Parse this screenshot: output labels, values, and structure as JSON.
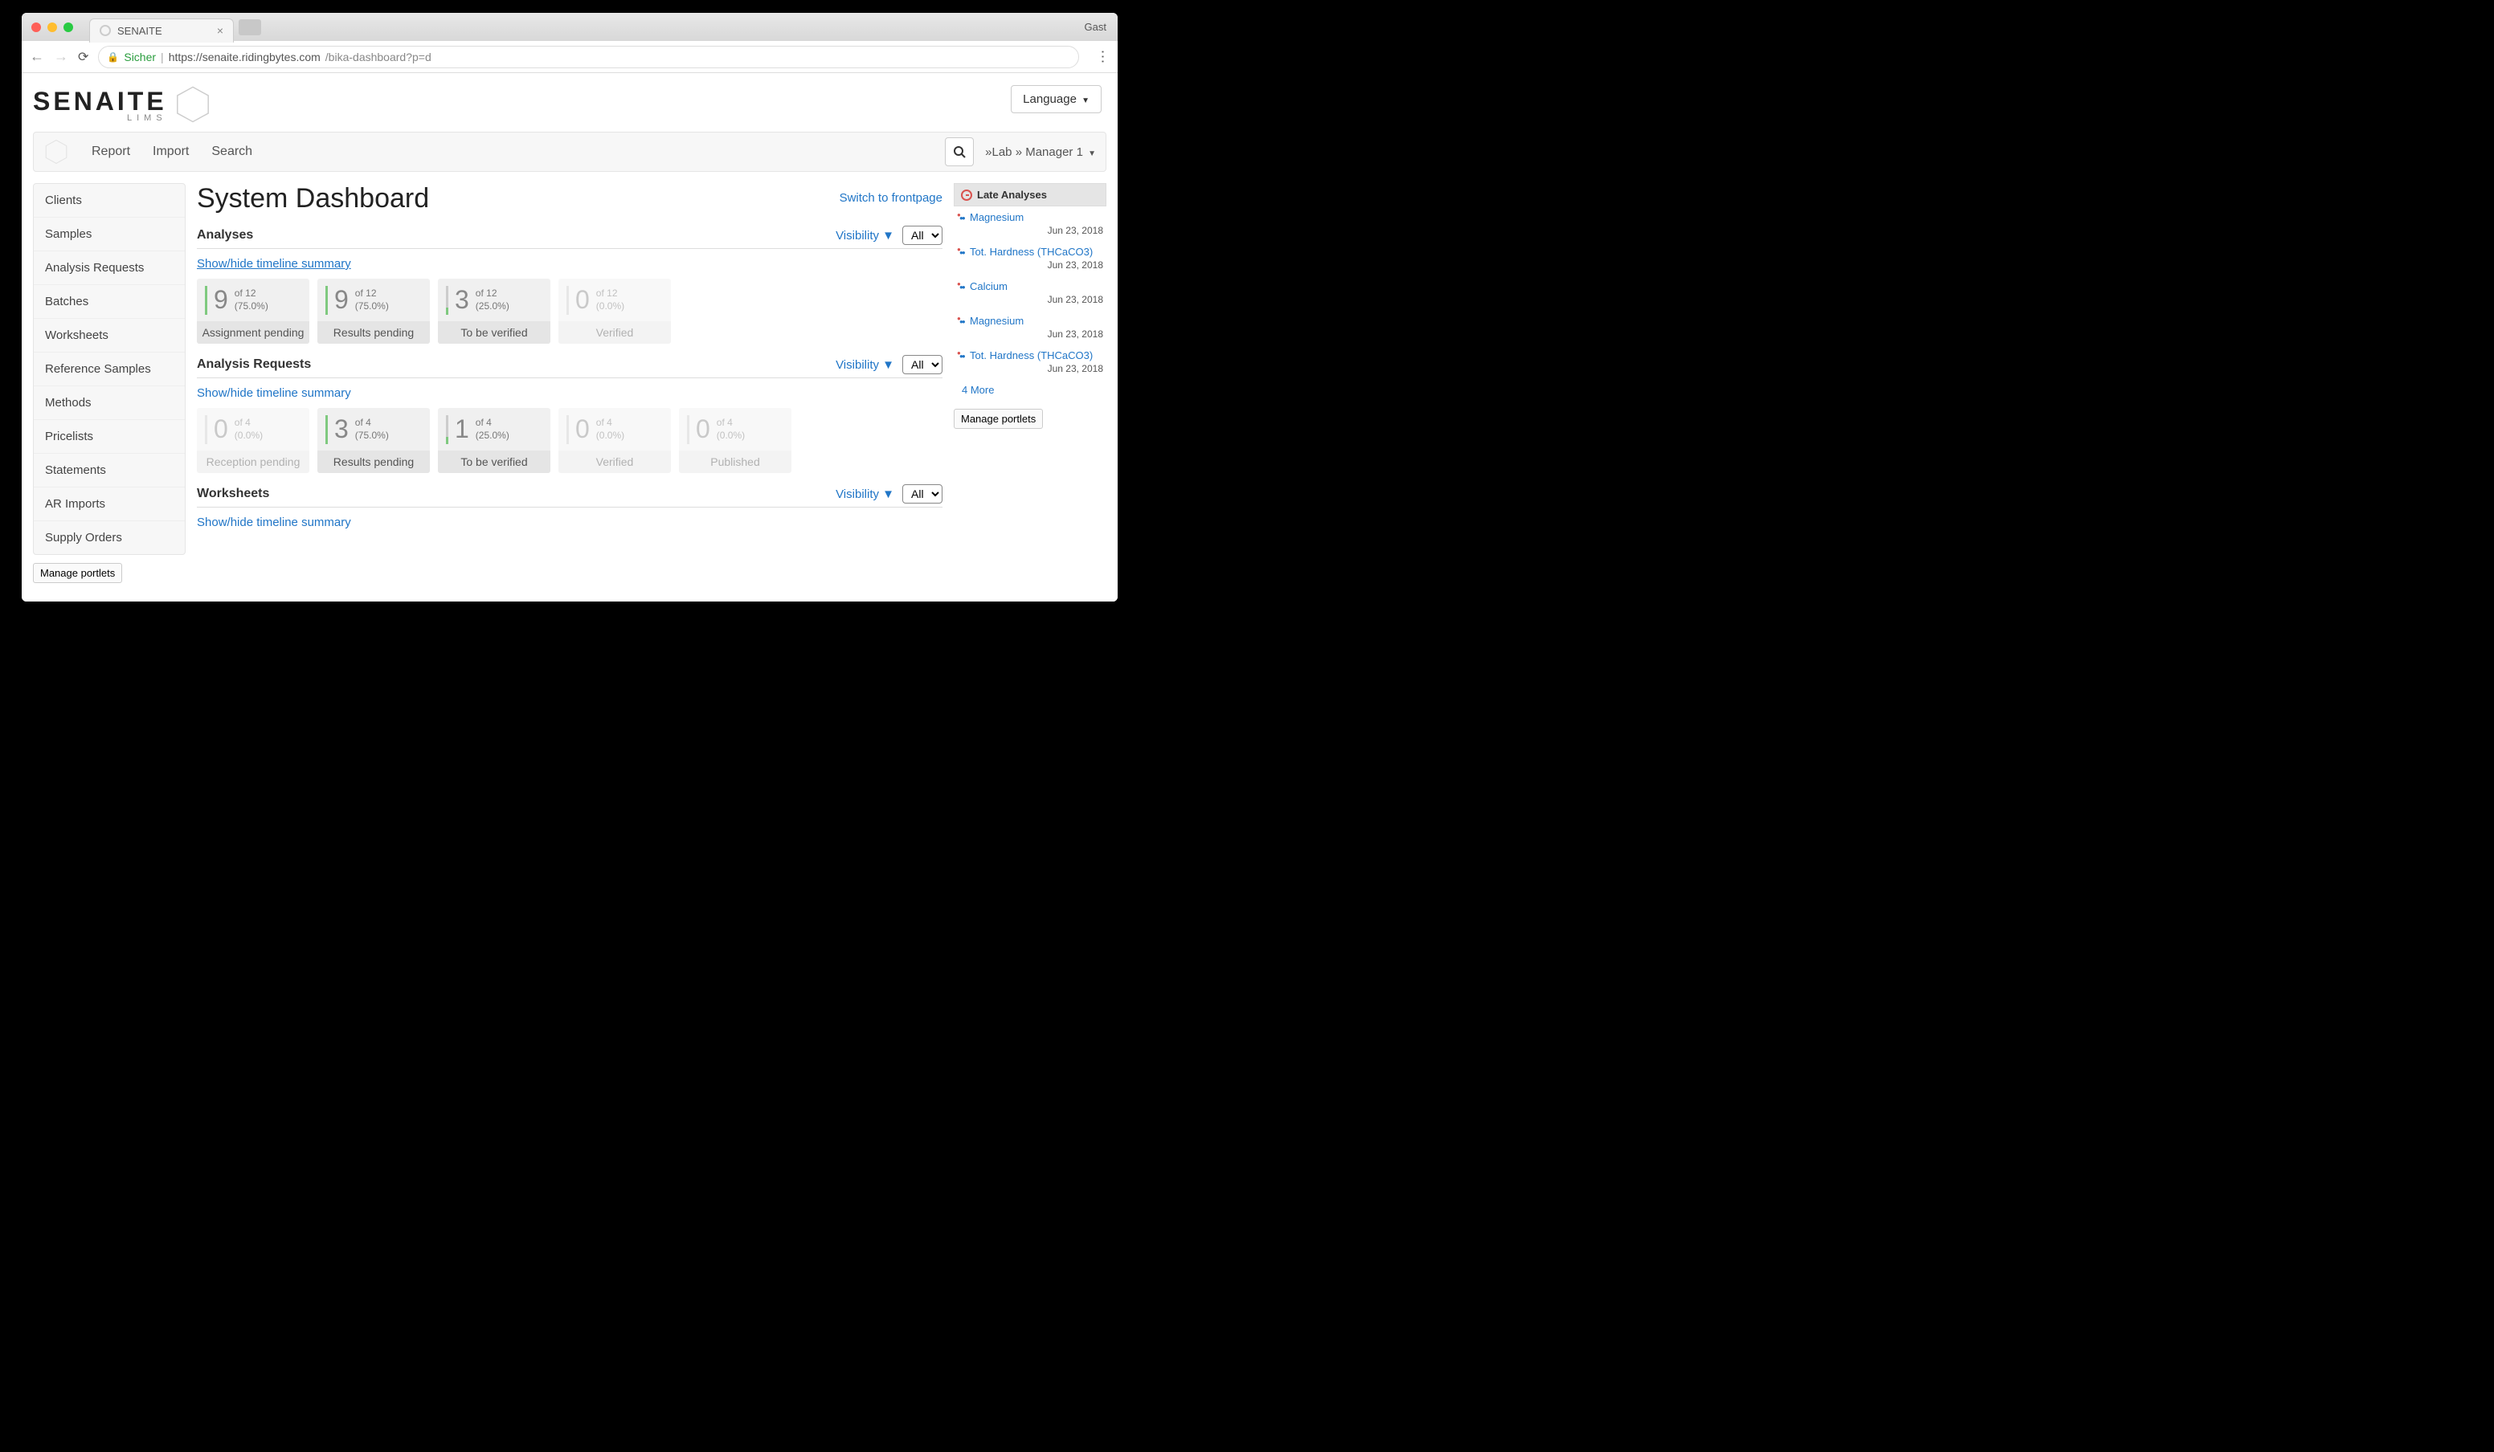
{
  "browser": {
    "tab_title": "SENAITE",
    "user_label": "Gast",
    "secure_label": "Sicher",
    "url_host": "https://senaite.ridingbytes.com",
    "url_path": "/bika-dashboard?p=d"
  },
  "header": {
    "logo_main": "SENAITE",
    "logo_sub": "LIMS",
    "language_btn": "Language"
  },
  "nav": {
    "items": [
      "Report",
      "Import",
      "Search"
    ],
    "user_menu": "»Lab » Manager 1"
  },
  "sidebar": {
    "items": [
      "Clients",
      "Samples",
      "Analysis Requests",
      "Batches",
      "Worksheets",
      "Reference Samples",
      "Methods",
      "Pricelists",
      "Statements",
      "AR Imports",
      "Supply Orders"
    ],
    "manage_btn": "Manage portlets"
  },
  "dashboard": {
    "title": "System Dashboard",
    "switch_link": "Switch to frontpage",
    "visibility_label": "Visibility",
    "filter_value": "All",
    "timeline_link": "Show/hide timeline summary"
  },
  "sections": [
    {
      "title": "Analyses",
      "cards": [
        {
          "num": "9",
          "of": "of 12",
          "pct": "(75.0%)",
          "label": "Assignment pending",
          "faded": false,
          "bar": "full"
        },
        {
          "num": "9",
          "of": "of 12",
          "pct": "(75.0%)",
          "label": "Results pending",
          "faded": false,
          "bar": "full"
        },
        {
          "num": "3",
          "of": "of 12",
          "pct": "(25.0%)",
          "label": "To be verified",
          "faded": false,
          "bar": "partial"
        },
        {
          "num": "0",
          "of": "of 12",
          "pct": "(0.0%)",
          "label": "Verified",
          "faded": true,
          "bar": "gray"
        }
      ]
    },
    {
      "title": "Analysis Requests",
      "cards": [
        {
          "num": "0",
          "of": "of 4",
          "pct": "(0.0%)",
          "label": "Reception pending",
          "faded": true,
          "bar": "gray"
        },
        {
          "num": "3",
          "of": "of 4",
          "pct": "(75.0%)",
          "label": "Results pending",
          "faded": false,
          "bar": "full"
        },
        {
          "num": "1",
          "of": "of 4",
          "pct": "(25.0%)",
          "label": "To be verified",
          "faded": false,
          "bar": "partial"
        },
        {
          "num": "0",
          "of": "of 4",
          "pct": "(0.0%)",
          "label": "Verified",
          "faded": true,
          "bar": "gray"
        },
        {
          "num": "0",
          "of": "of 4",
          "pct": "(0.0%)",
          "label": "Published",
          "faded": true,
          "bar": "gray"
        }
      ]
    },
    {
      "title": "Worksheets",
      "cards": []
    }
  ],
  "late_analyses": {
    "header": "Late Analyses",
    "items": [
      {
        "name": "Magnesium",
        "date": "Jun 23, 2018"
      },
      {
        "name": "Tot. Hardness (THCaCO3)",
        "date": "Jun 23, 2018"
      },
      {
        "name": "Calcium",
        "date": "Jun 23, 2018"
      },
      {
        "name": "Magnesium",
        "date": "Jun 23, 2018"
      },
      {
        "name": "Tot. Hardness (THCaCO3)",
        "date": "Jun 23, 2018"
      }
    ],
    "more": "4 More",
    "manage_btn": "Manage portlets"
  }
}
